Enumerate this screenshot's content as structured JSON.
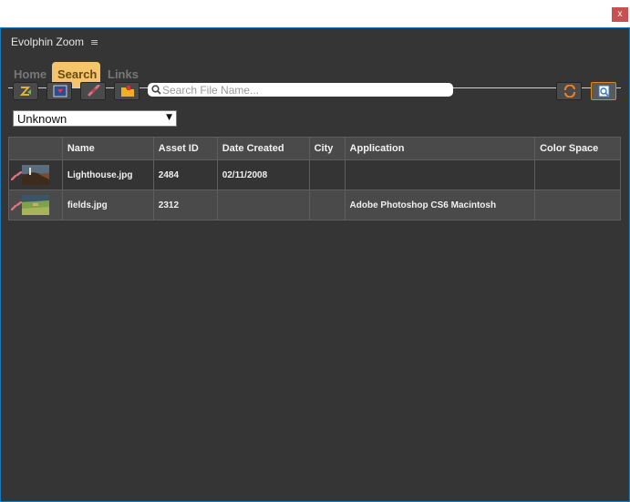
{
  "window": {
    "close_label": "x"
  },
  "panel": {
    "title": "Evolphin Zoom",
    "menu_icon": "hamburger-icon"
  },
  "tabs": [
    {
      "label": "Home",
      "active": false
    },
    {
      "label": "Search",
      "active": true
    },
    {
      "label": "Links",
      "active": false
    }
  ],
  "toolbar": {
    "buttons": [
      {
        "name": "checkin-icon"
      },
      {
        "name": "place-icon"
      },
      {
        "name": "link-icon"
      },
      {
        "name": "folder-icon"
      }
    ],
    "right_buttons": [
      {
        "name": "refresh-icon"
      },
      {
        "name": "preview-icon",
        "active": true
      }
    ]
  },
  "search": {
    "placeholder": "Search File Name..."
  },
  "filter": {
    "selected": "Unknown"
  },
  "table": {
    "columns": [
      "",
      "Name",
      "Asset ID",
      "Date Created",
      "City",
      "Application",
      "Color Space"
    ],
    "rows": [
      {
        "name": "Lighthouse.jpg",
        "asset_id": "2484",
        "date_created": "02/11/2008",
        "city": "",
        "application": "",
        "color_space": ""
      },
      {
        "name": "fields.jpg",
        "asset_id": "2312",
        "date_created": "",
        "city": "",
        "application": "Adobe Photoshop CS6 Macintosh",
        "color_space": ""
      }
    ]
  },
  "colors": {
    "panel_bg": "#353535",
    "active_tab": "#f4c56a",
    "border": "#1d7ab8"
  }
}
